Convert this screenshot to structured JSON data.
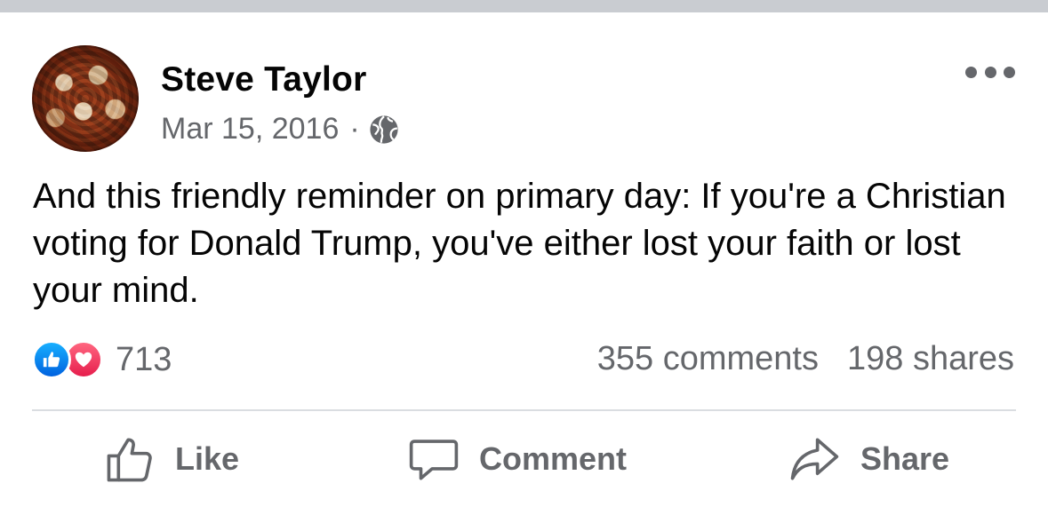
{
  "post": {
    "author": "Steve Taylor",
    "date": "Mar 15, 2016",
    "separator": "·",
    "privacy_icon": "globe-icon",
    "more_icon": "more-options-icon",
    "text": "And this friendly reminder on primary day: If you're a Christian voting for Donald Trump, you've either lost your faith or lost your mind."
  },
  "stats": {
    "reaction_icons": [
      "like-reaction-icon",
      "love-reaction-icon"
    ],
    "reaction_count": "713",
    "comments": "355 comments",
    "shares": "198 shares"
  },
  "actions": {
    "like_label": "Like",
    "comment_label": "Comment",
    "share_label": "Share"
  },
  "colors": {
    "text_primary": "#050505",
    "text_secondary": "#65676b",
    "like_blue": "#0866ff",
    "love_red": "#f33e58",
    "divider": "#dadde1"
  }
}
